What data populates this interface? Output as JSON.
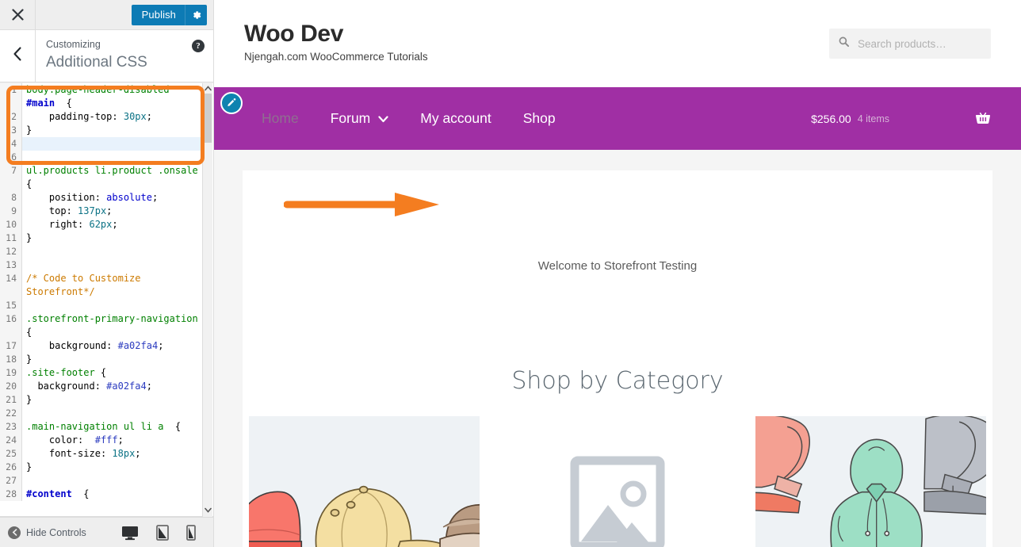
{
  "customizer": {
    "close_label": "Close",
    "publish_label": "Publish",
    "gear_icon": "gear-icon",
    "close_icon": "close-icon",
    "back_icon": "chevron-left-icon",
    "help_icon": "help-icon",
    "help_label": "?",
    "eyebrow": "Customizing",
    "title": "Additional CSS",
    "hide_controls_label": "Hide Controls",
    "devices": [
      {
        "name": "desktop",
        "label": "Desktop",
        "active": true
      },
      {
        "name": "tablet",
        "label": "Tablet",
        "active": false
      },
      {
        "name": "mobile",
        "label": "Mobile",
        "active": false
      }
    ],
    "highlight_color": "#f47d20",
    "accent_color": "#0d7bb5",
    "code_lines": [
      {
        "num": "1",
        "text": "body.page-header-disabled #main {"
      },
      {
        "num": "2",
        "text": "    padding-top: 30px;"
      },
      {
        "num": "3",
        "text": "}"
      },
      {
        "num": "4",
        "text": "",
        "active": true
      },
      {
        "num": "6",
        "text": ""
      },
      {
        "num": "7",
        "text": "ul.products li.product .onsale {"
      },
      {
        "num": "8",
        "text": "    position: absolute;"
      },
      {
        "num": "9",
        "text": "    top: 137px;"
      },
      {
        "num": "10",
        "text": "    right: 62px;"
      },
      {
        "num": "11",
        "text": "}"
      },
      {
        "num": "12",
        "text": ""
      },
      {
        "num": "13",
        "text": ""
      },
      {
        "num": "14",
        "text": "/* Code to Customize Storefront*/"
      },
      {
        "num": "15",
        "text": ""
      },
      {
        "num": "16",
        "text": ".storefront-primary-navigation {"
      },
      {
        "num": "17",
        "text": "    background: #a02fa4;"
      },
      {
        "num": "18",
        "text": "}"
      },
      {
        "num": "19",
        "text": ".site-footer{"
      },
      {
        "num": "20",
        "text": "  background: #a02fa4;"
      },
      {
        "num": "21",
        "text": "}"
      },
      {
        "num": "22",
        "text": ""
      },
      {
        "num": "23",
        "text": ".main-navigation ul li a {"
      },
      {
        "num": "24",
        "text": "    color:  #fff;"
      },
      {
        "num": "25",
        "text": "    font-size: 18px;"
      },
      {
        "num": "26",
        "text": "}"
      },
      {
        "num": "27",
        "text": ""
      },
      {
        "num": "28",
        "text": "#content {"
      }
    ]
  },
  "site": {
    "title": "Woo Dev",
    "tagline": "Njengah.com WooCommerce Tutorials",
    "search": {
      "placeholder": "Search products…",
      "value": "",
      "icon": "search-icon"
    },
    "nav": {
      "edit_icon": "pencil-icon",
      "background": "#a02fa4",
      "links": [
        {
          "label": "Home",
          "current": true,
          "has_dropdown": false
        },
        {
          "label": "Forum",
          "current": false,
          "has_dropdown": true
        },
        {
          "label": "My account",
          "current": false,
          "has_dropdown": false
        },
        {
          "label": "Shop",
          "current": false,
          "has_dropdown": false
        }
      ],
      "cart": {
        "amount": "$256.00",
        "count": "4 items",
        "icon": "basket-icon"
      }
    },
    "content": {
      "annotation_arrow": "orange-arrow",
      "welcome_text": "Welcome to Storefront Testing",
      "category_heading": "Shop by Category",
      "categories": [
        {
          "name": "caps",
          "type": "illustration"
        },
        {
          "name": "placeholder",
          "type": "placeholder"
        },
        {
          "name": "hoodies",
          "type": "illustration"
        }
      ]
    }
  }
}
